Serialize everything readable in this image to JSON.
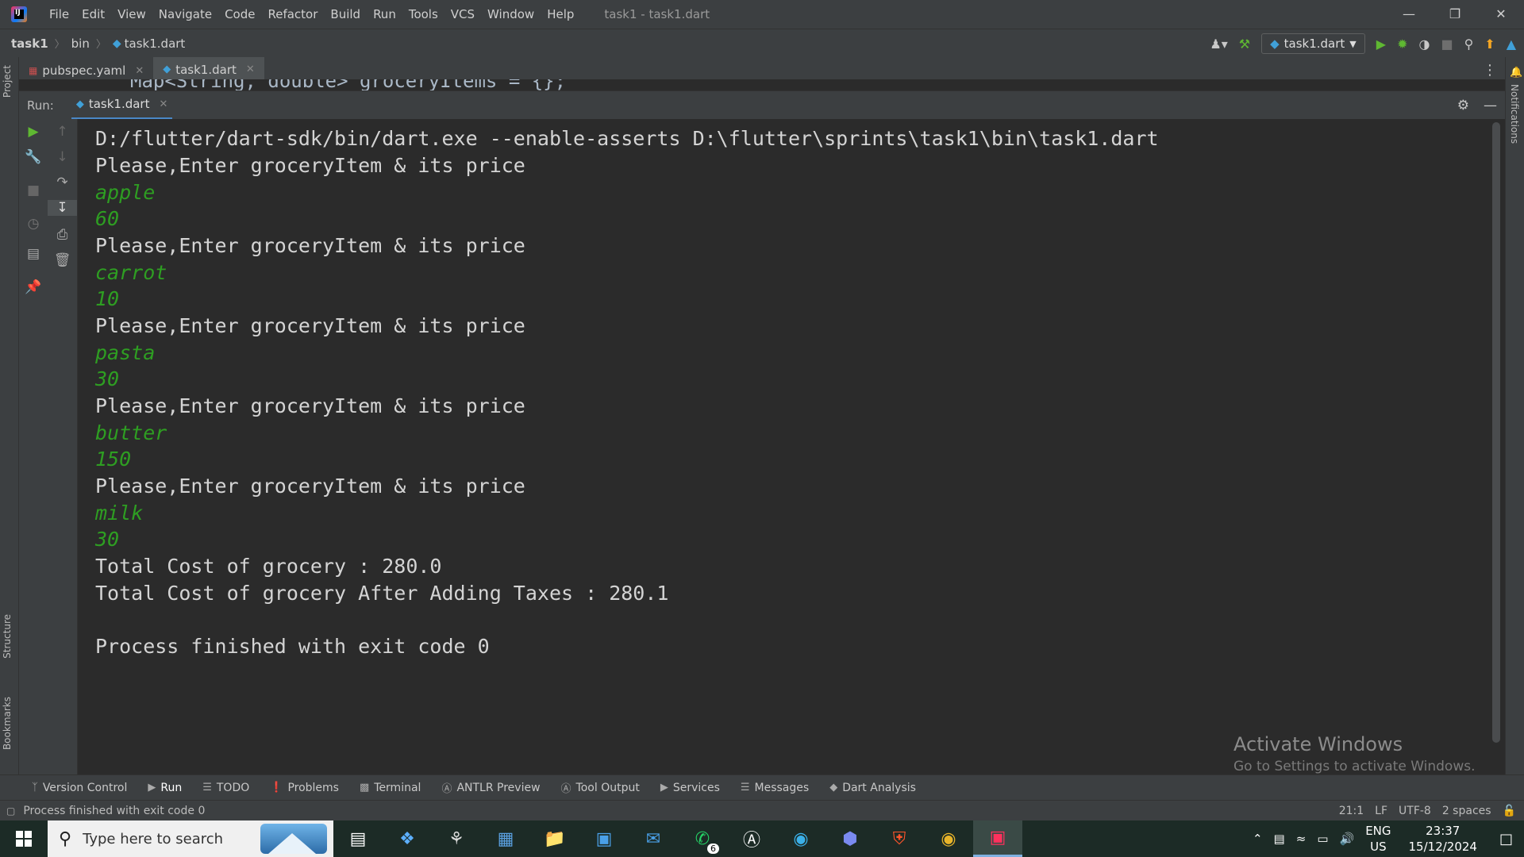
{
  "title_bar": {
    "menu": [
      "File",
      "Edit",
      "View",
      "Navigate",
      "Code",
      "Refactor",
      "Build",
      "Run",
      "Tools",
      "VCS",
      "Window",
      "Help"
    ],
    "window_title": "task1 - task1.dart",
    "controls": [
      "minimize",
      "restore",
      "close"
    ]
  },
  "nav_bar": {
    "breadcrumbs": [
      "task1",
      "bin",
      "task1.dart"
    ],
    "run_config": "task1.dart"
  },
  "stripes": {
    "left": [
      "Project",
      "Structure",
      "Bookmarks"
    ],
    "right": [
      "Notifications"
    ]
  },
  "editor": {
    "tabs": [
      {
        "label": "pubspec.yaml",
        "active": false
      },
      {
        "label": "task1.dart",
        "active": true
      }
    ],
    "peek_line": "Map<String, double> groceryItems = {};"
  },
  "run_panel": {
    "label": "Run:",
    "tab": "task1.dart"
  },
  "console": {
    "lines": [
      {
        "text": "D:/flutter/dart-sdk/bin/dart.exe --enable-asserts D:\\flutter\\sprints\\task1\\bin\\task1.dart",
        "type": "output"
      },
      {
        "text": "Please,Enter groceryItem & its price",
        "type": "output"
      },
      {
        "text": "apple",
        "type": "input"
      },
      {
        "text": "60",
        "type": "input"
      },
      {
        "text": "Please,Enter groceryItem & its price",
        "type": "output"
      },
      {
        "text": "carrot",
        "type": "input"
      },
      {
        "text": "10",
        "type": "input"
      },
      {
        "text": "Please,Enter groceryItem & its price",
        "type": "output"
      },
      {
        "text": "pasta",
        "type": "input"
      },
      {
        "text": "30",
        "type": "input"
      },
      {
        "text": "Please,Enter groceryItem & its price",
        "type": "output"
      },
      {
        "text": "butter",
        "type": "input"
      },
      {
        "text": "150",
        "type": "input"
      },
      {
        "text": "Please,Enter groceryItem & its price",
        "type": "output"
      },
      {
        "text": "milk",
        "type": "input"
      },
      {
        "text": "30",
        "type": "input"
      },
      {
        "text": "Total Cost of grocery : 280.0",
        "type": "output"
      },
      {
        "text": "Total Cost of grocery After Adding Taxes : 280.1",
        "type": "output"
      },
      {
        "text": "",
        "type": "output"
      },
      {
        "text": "Process finished with exit code 0",
        "type": "output"
      }
    ]
  },
  "watermark": {
    "title": "Activate Windows",
    "subtitle": "Go to Settings to activate Windows."
  },
  "tool_windows": [
    "Version Control",
    "Run",
    "TODO",
    "Problems",
    "Terminal",
    "ANTLR Preview",
    "Tool Output",
    "Services",
    "Messages",
    "Dart Analysis"
  ],
  "status_bar": {
    "message": "Process finished with exit code 0",
    "position": "21:1",
    "line_sep": "LF",
    "encoding": "UTF-8",
    "indent": "2 spaces"
  },
  "taskbar": {
    "search_placeholder": "Type here to search",
    "whatsapp_badge": "6",
    "lang_top": "ENG",
    "lang_bottom": "US",
    "time": "23:37",
    "date": "15/12/2024"
  },
  "colors": {
    "ide_bg": "#2b2b2b",
    "panel_bg": "#3c3f41",
    "input_text": "#2e9e22",
    "accent": "#4a88c7"
  }
}
